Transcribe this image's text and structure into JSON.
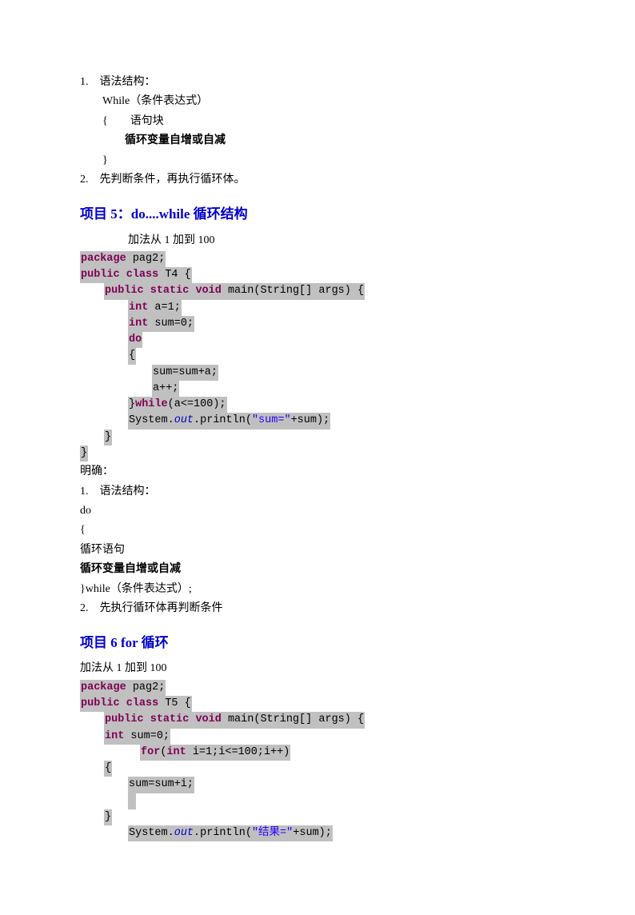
{
  "section1": {
    "item1_label": "1.　语法结构：",
    "line2": "While（条件表达式）",
    "line3": "{　　语句块",
    "line4_bold": "循环变量自增或自减",
    "line5": "}",
    "item2_label": "2.　先判断条件，再执行循环体。"
  },
  "heading5": "项目 5：do....while 循环结构",
  "section5": {
    "subtitle": "加法从 1 加到 100",
    "code": {
      "l1": {
        "kw": "package",
        "rest": " pag2;"
      },
      "l2": {
        "kw1": "public",
        "kw2": "class",
        "rest": " T4 {"
      },
      "l3": {
        "kw1": "public",
        "kw2": "static",
        "kw3": "void",
        "rest": " main(String[] args) {"
      },
      "l4": {
        "kw": "int",
        "rest": " a=1;"
      },
      "l5": {
        "kw": "int",
        "rest": " sum=0;"
      },
      "l6": {
        "kw": "do"
      },
      "l7": {
        "rest": "{"
      },
      "l8": {
        "rest": "sum=sum+a;"
      },
      "l9": {
        "rest": "a++;"
      },
      "l10": {
        "rest1": "}",
        "kw": "while",
        "rest2": "(a<=100);"
      },
      "l11": {
        "rest1": "System.",
        "it": "out",
        "rest2": ".println(",
        "str": "\"sum=\"",
        "rest3": "+sum);"
      },
      "l12": {
        "rest": "}"
      },
      "l13": {
        "rest": "}"
      }
    },
    "after": {
      "mq": "明确：",
      "item1": "1.　语法结构：",
      "do": "do",
      "brace": "{",
      "loop": "循环语句",
      "bold": "循环变量自增或自减",
      "close": "}while（条件表达式）;",
      "item2": "2.　先执行循环体再判断条件"
    }
  },
  "heading6": "项目 6 for 循环",
  "section6": {
    "subtitle": "加法从 1 加到 100",
    "code": {
      "l1": {
        "kw": "package",
        "rest": " pag2;"
      },
      "l2": {
        "kw1": "public",
        "kw2": "class",
        "rest": " T5 {"
      },
      "l3": {
        "kw1": "public",
        "kw2": "static",
        "kw3": "void",
        "rest": " main(String[] args) {"
      },
      "l4": {
        "kw": "int",
        "rest": " sum=0;"
      },
      "l5": {
        "kw1": "for",
        "rest1": "(",
        "kw2": "int",
        "rest2": " i=1;i<=100;i++)"
      },
      "l6": {
        "rest": "{"
      },
      "l7": {
        "rest": "sum=sum+i;"
      },
      "l8_blank": " ",
      "l9": {
        "rest": "}"
      },
      "l10": {
        "rest1": "System.",
        "it": "out",
        "rest2": ".println(",
        "str": "\"结果=\"",
        "rest3": "+sum);"
      }
    }
  }
}
